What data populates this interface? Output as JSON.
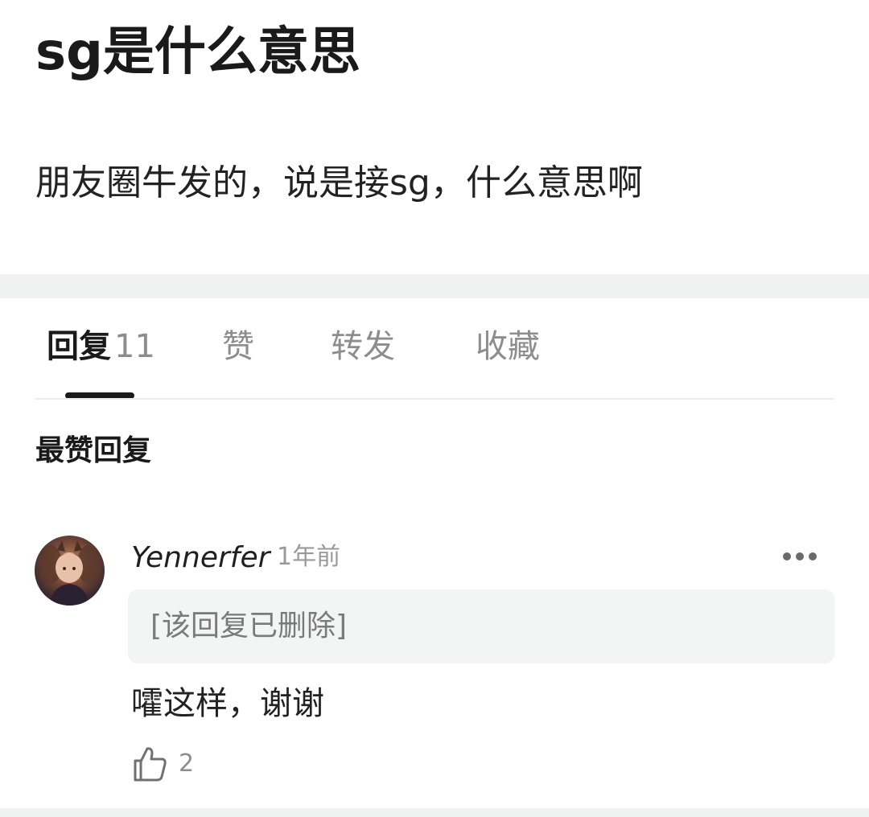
{
  "post": {
    "title": "sg是什么意思",
    "body": "朋友圈牛发的，说是接sg，什么意思啊"
  },
  "tabs": [
    {
      "label": "回复",
      "count": "11",
      "active": true
    },
    {
      "label": "赞"
    },
    {
      "label": "转发"
    },
    {
      "label": "收藏"
    }
  ],
  "section": {
    "heading": "最赞回复"
  },
  "reply": {
    "username": "Yennerfer",
    "time": "1年前",
    "quoted": "[该回复已删除]",
    "text": "嚯这样，谢谢",
    "like_count": "2"
  },
  "icons": {
    "more": "more-dots-icon",
    "like": "thumbs-up-icon"
  },
  "colors": {
    "text_primary": "#1a1a1a",
    "text_secondary": "#8d8d8d",
    "divider_band": "#f0f2f2",
    "quote_background": "#f3f4f4"
  }
}
